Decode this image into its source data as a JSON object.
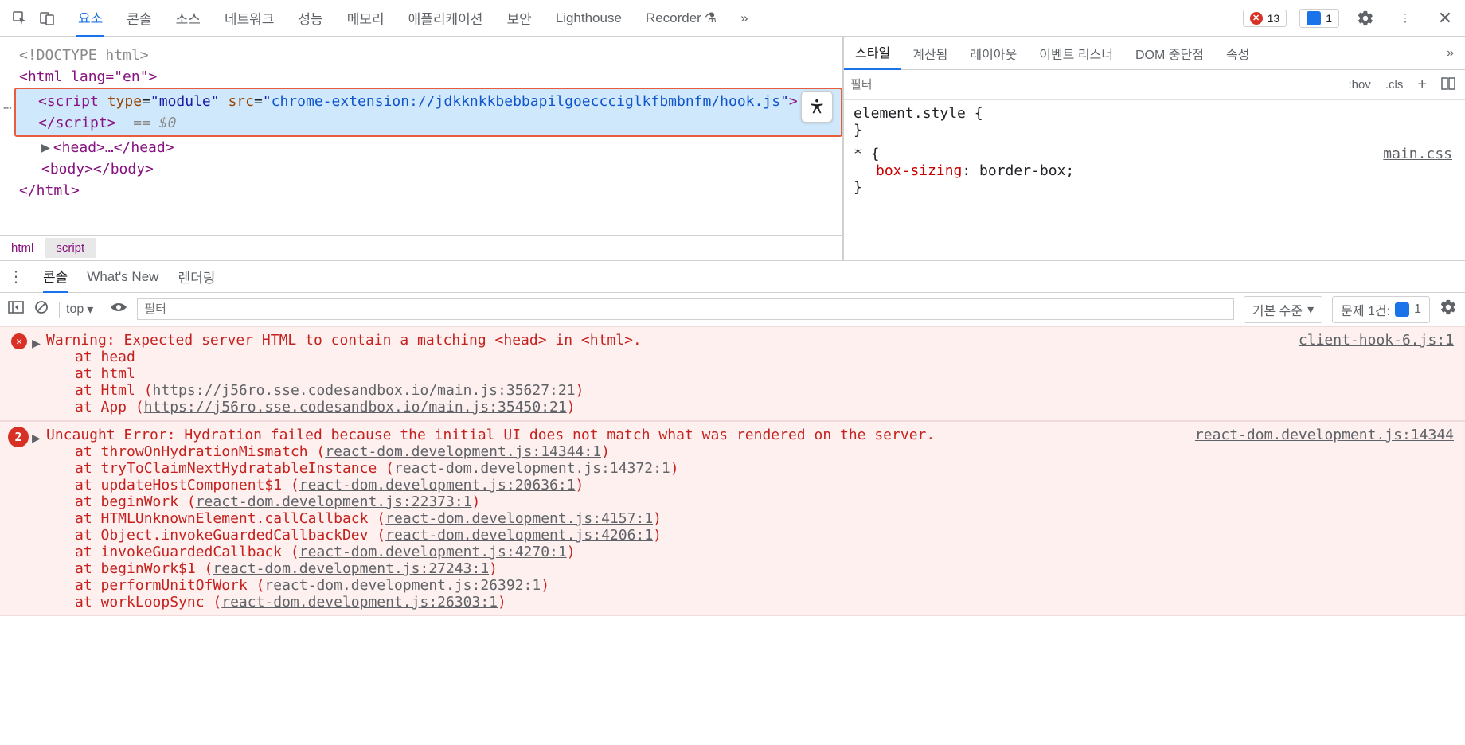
{
  "topbar": {
    "tabs": [
      "요소",
      "콘솔",
      "소스",
      "네트워크",
      "성능",
      "메모리",
      "애플리케이션",
      "보안",
      "Lighthouse",
      "Recorder"
    ],
    "err_count": "13",
    "info_count": "1"
  },
  "dom": {
    "doctype": "<!DOCTYPE html>",
    "html_open": "<html lang=\"en\">",
    "script_prefix": "<script type=\"module\" src=\"",
    "script_url": "chrome-extension://jdkknkkbebbapilgoeccciglkfbmbnfm/hook.js",
    "script_suffix": "\"></script>",
    "eqdollar": "== $0",
    "head": "<head>…</head>",
    "body": "<body></body>",
    "html_close": "</html>"
  },
  "crumbs": {
    "a": "html",
    "b": "script"
  },
  "styles": {
    "tabs": [
      "스타일",
      "계산됨",
      "레이아웃",
      "이벤트 리스너",
      "DOM 중단점",
      "속성"
    ],
    "filter_placeholder": "필터",
    "hov": ":hov",
    "cls": ".cls",
    "rule1_sel": "element.style {",
    "rule1_close": "}",
    "rule2_sel": "* {",
    "rule2_src": "main.css",
    "rule2_prop": "box-sizing",
    "rule2_val": ": border-box;",
    "rule2_close": "}"
  },
  "drawer": {
    "tabs": [
      "콘솔",
      "What's New",
      "렌더링"
    ]
  },
  "console": {
    "context": "top",
    "filter_placeholder": "필터",
    "level": "기본 수준",
    "issues_label": "문제 1건:",
    "issues_count": "1",
    "msg1": {
      "text": "Warning: Expected server HTML to contain a matching <head> in <html>.",
      "src": "client-hook-6.js:1",
      "stack": [
        {
          "pre": "at head",
          "link": ""
        },
        {
          "pre": "at html",
          "link": ""
        },
        {
          "pre": "at Html (",
          "link": "https://j56ro.sse.codesandbox.io/main.js:35627:21",
          "post": ")"
        },
        {
          "pre": "at App (",
          "link": "https://j56ro.sse.codesandbox.io/main.js:35450:21",
          "post": ")"
        }
      ]
    },
    "msg2": {
      "badge": "2",
      "text": "Uncaught Error: Hydration failed because the initial UI does not match what was rendered on the server.",
      "src": "react-dom.development.js:14344",
      "stack": [
        {
          "pre": "at throwOnHydrationMismatch (",
          "link": "react-dom.development.js:14344:1",
          "post": ")"
        },
        {
          "pre": "at tryToClaimNextHydratableInstance (",
          "link": "react-dom.development.js:14372:1",
          "post": ")"
        },
        {
          "pre": "at updateHostComponent$1 (",
          "link": "react-dom.development.js:20636:1",
          "post": ")"
        },
        {
          "pre": "at beginWork (",
          "link": "react-dom.development.js:22373:1",
          "post": ")"
        },
        {
          "pre": "at HTMLUnknownElement.callCallback (",
          "link": "react-dom.development.js:4157:1",
          "post": ")"
        },
        {
          "pre": "at Object.invokeGuardedCallbackDev (",
          "link": "react-dom.development.js:4206:1",
          "post": ")"
        },
        {
          "pre": "at invokeGuardedCallback (",
          "link": "react-dom.development.js:4270:1",
          "post": ")"
        },
        {
          "pre": "at beginWork$1 (",
          "link": "react-dom.development.js:27243:1",
          "post": ")"
        },
        {
          "pre": "at performUnitOfWork (",
          "link": "react-dom.development.js:26392:1",
          "post": ")"
        },
        {
          "pre": "at workLoopSync (",
          "link": "react-dom.development.js:26303:1",
          "post": ")"
        }
      ]
    }
  }
}
